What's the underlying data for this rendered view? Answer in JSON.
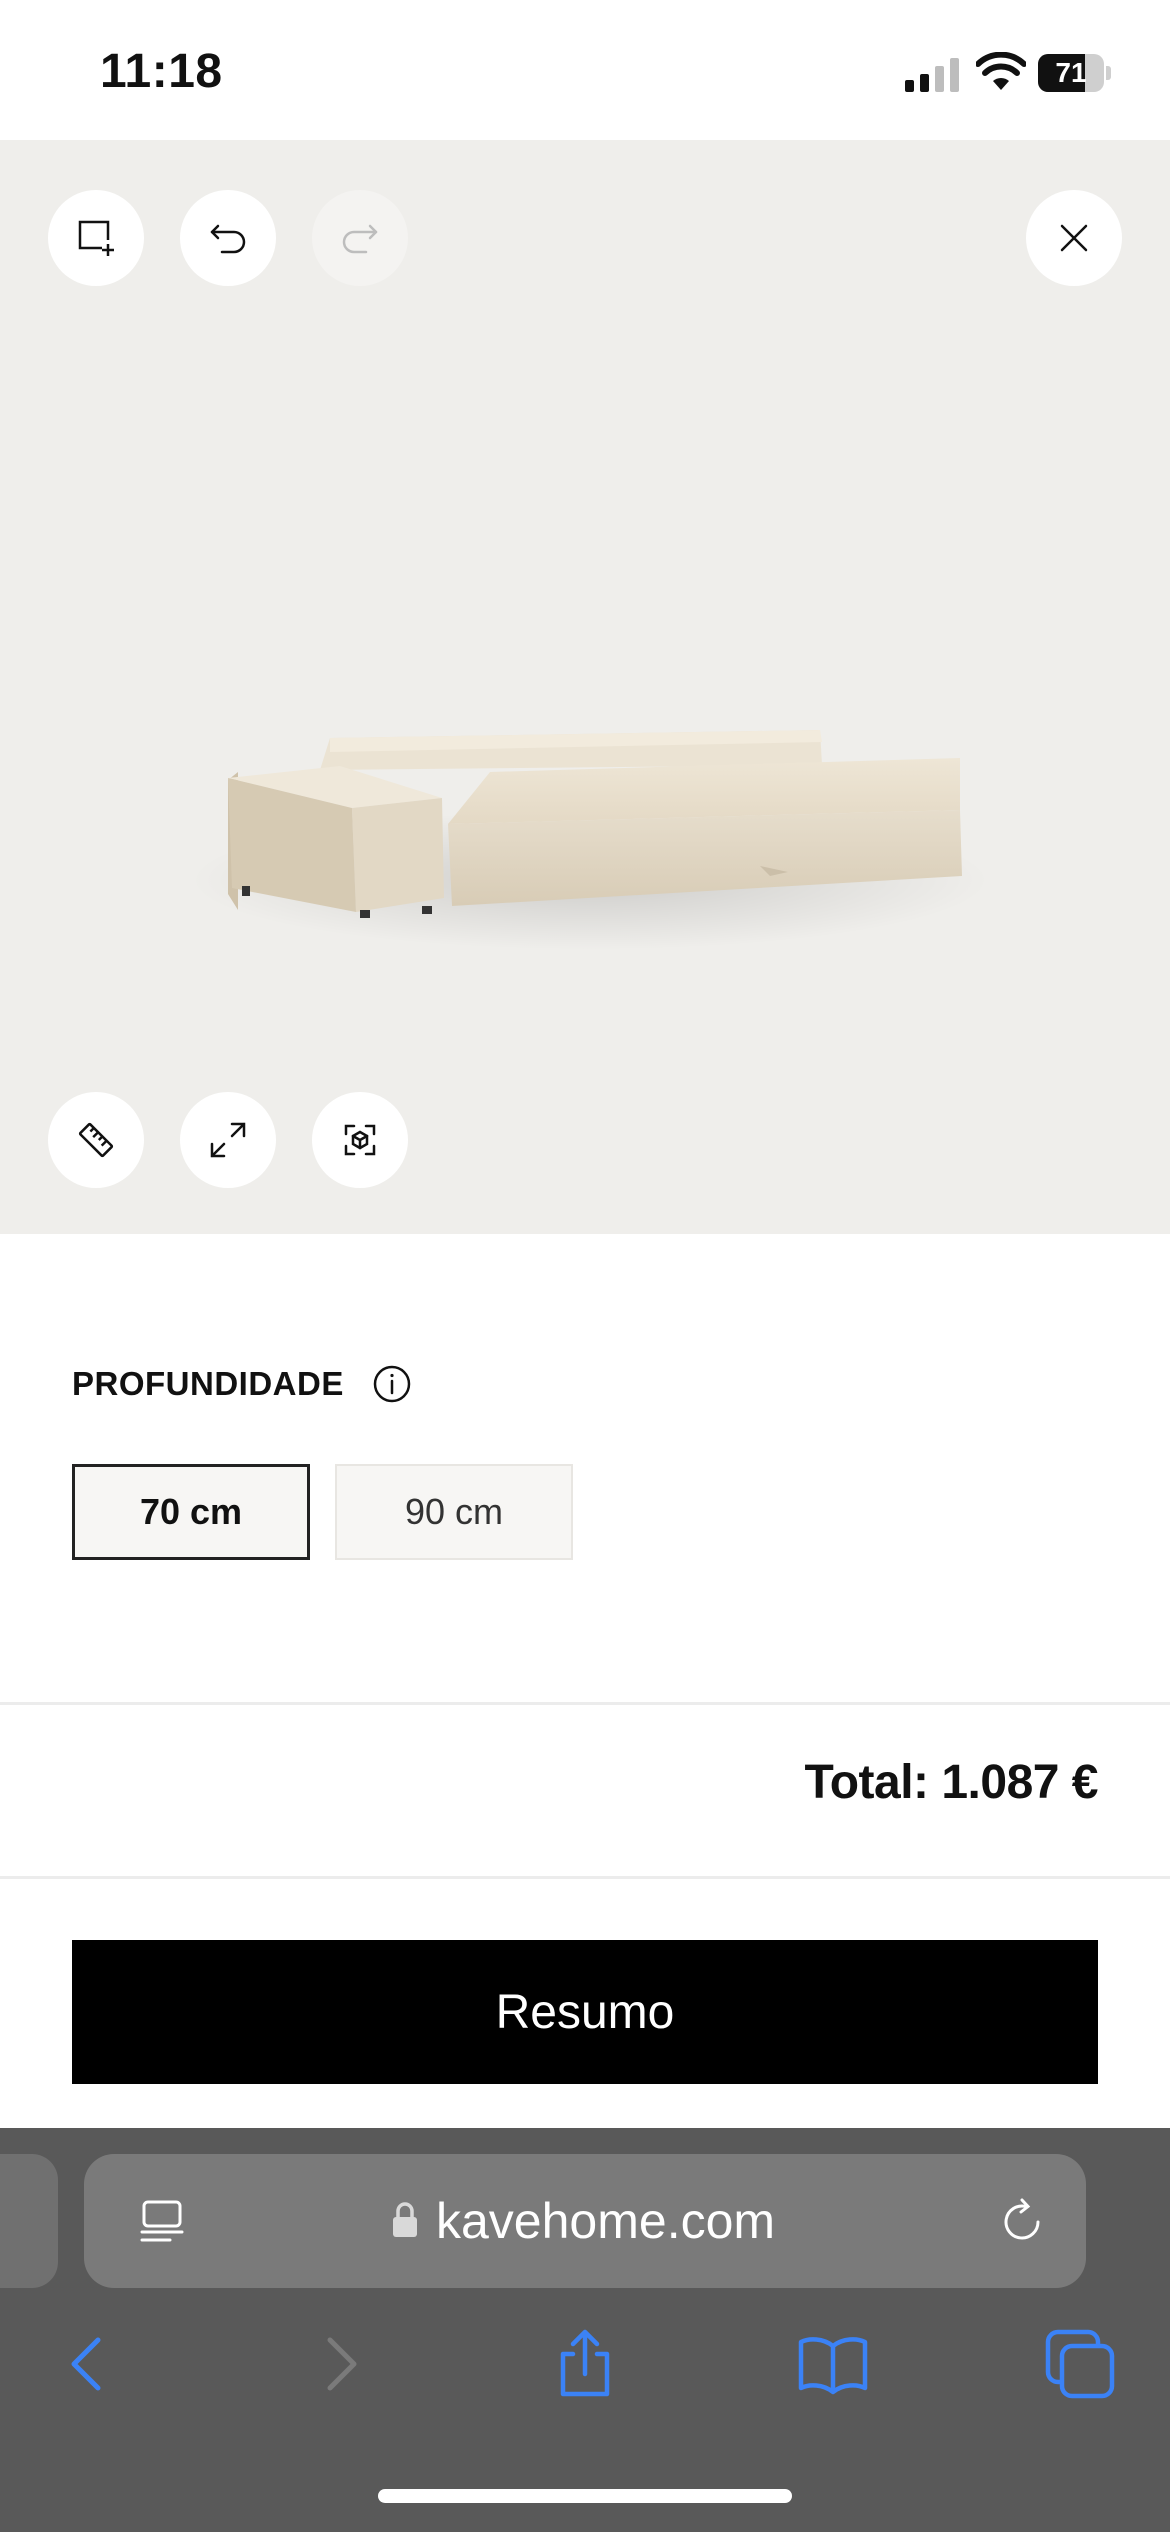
{
  "status": {
    "time": "11:18",
    "battery": "71",
    "battery_level": 0.71,
    "signal_bars": 2
  },
  "viewer": {
    "top_left_icons": [
      "add-module-icon",
      "undo-icon",
      "redo-icon"
    ],
    "top_right_icon": "close-icon",
    "bottom_icons": [
      "ruler-icon",
      "expand-icon",
      "ar-view-icon"
    ],
    "image": "beige-sofa-module"
  },
  "options": {
    "label": "PROFUNDIDADE",
    "sizes": [
      {
        "label": "70 cm",
        "selected": true
      },
      {
        "label": "90 cm",
        "selected": false
      }
    ]
  },
  "total": "Total: 1.087 €",
  "summary_button": "Resumo",
  "browser": {
    "url": "kavehome.com"
  },
  "colors": {
    "viewer_bg": "#efeeeb",
    "primary_button": "#000000",
    "browser_accent": "#3b82f6",
    "browser_bar": "#595959"
  }
}
